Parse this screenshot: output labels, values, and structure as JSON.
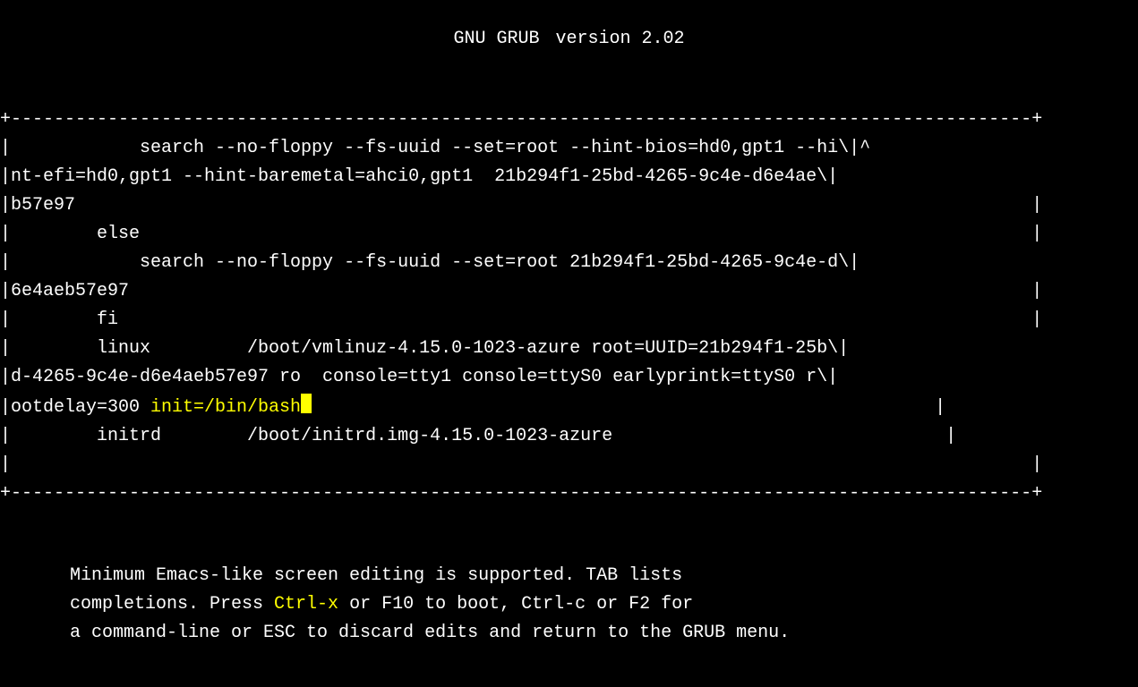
{
  "title_left": "GNU GRUB",
  "title_right": "version 2.02",
  "border_top": "+-----------------------------------------------------------------------------------------------+",
  "border_bottom": "+-----------------------------------------------------------------------------------------------+",
  "scroll_indicator": "^",
  "lines": {
    "l1": "|            search --no-floppy --fs-uuid --set=root --hint-bios=hd0,gpt1 --hi\\|",
    "l2": "|nt-efi=hd0,gpt1 --hint-baremetal=ahci0,gpt1  21b294f1-25bd-4265-9c4e-d6e4ae\\|",
    "l3": "|b57e97                                                                                         |",
    "l4": "|        else                                                                                   |",
    "l5": "|            search --no-floppy --fs-uuid --set=root 21b294f1-25bd-4265-9c4e-d\\|",
    "l6": "|6e4aeb57e97                                                                                    |",
    "l7": "|        fi                                                                                     |",
    "l8": "|        linux         /boot/vmlinuz-4.15.0-1023-azure root=UUID=21b294f1-25b\\|",
    "l9": "|d-4265-9c4e-d6e4aeb57e97 ro  console=tty1 console=ttyS0 earlyprintk=ttyS0 r\\|",
    "l10p1": "|ootdelay=300 ",
    "l10p2": "init=/bin/bash",
    "l10p3": "                                                          |",
    "l11": "|        initrd        /boot/initrd.img-4.15.0-1023-azure                               |",
    "l12": "|                                                                                               |"
  },
  "footer": {
    "f1": "Minimum Emacs-like screen editing is supported. TAB lists",
    "f2a": "completions. Press ",
    "f2b": "Ctrl-x",
    "f2c": " or F10 to boot, Ctrl-c or F2 for",
    "f3": "a command-line or ESC to discard edits and return to the GRUB menu."
  }
}
